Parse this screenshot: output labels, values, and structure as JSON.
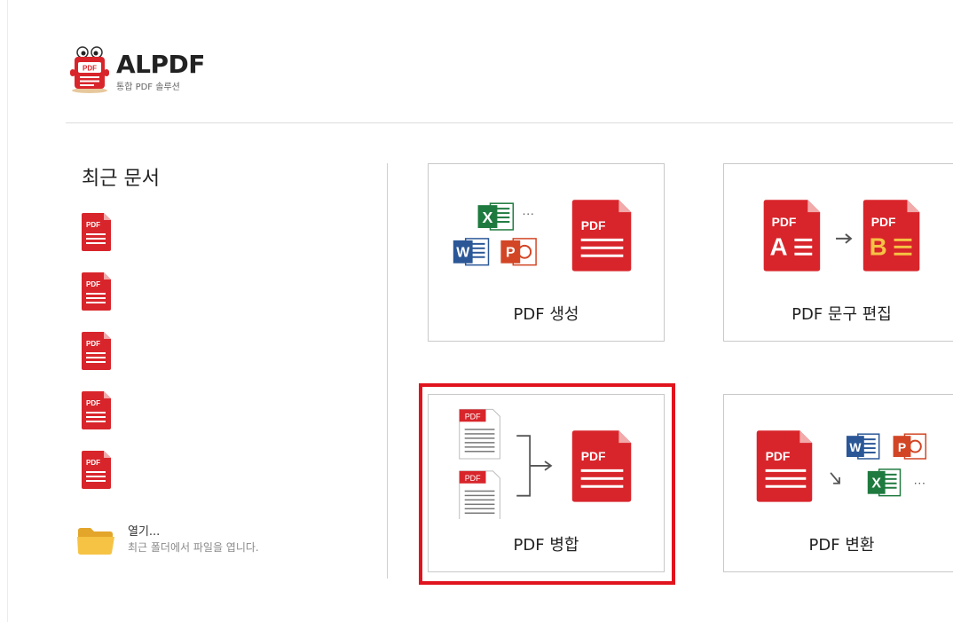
{
  "app": {
    "brand_name": "ALPDF",
    "brand_subtitle": "통합 PDF 솔루션",
    "logo_badge": "PDF"
  },
  "recent": {
    "title": "최근 문서",
    "doc_icon_label": "PDF",
    "items": [
      {
        "icon": "pdf-file-icon"
      },
      {
        "icon": "pdf-file-icon"
      },
      {
        "icon": "pdf-file-icon"
      },
      {
        "icon": "pdf-file-icon"
      },
      {
        "icon": "pdf-file-icon"
      }
    ]
  },
  "open": {
    "label": "열기...",
    "description": "최근 폴더에서 파일을 엽니다."
  },
  "tiles": {
    "create": {
      "label": "PDF 생성",
      "icon": "office-to-pdf-icon"
    },
    "edit": {
      "label": "PDF 문구 편집",
      "icon": "text-edit-icon",
      "letter_a": "A",
      "letter_b": "B"
    },
    "merge": {
      "label": "PDF 병합",
      "icon": "merge-icon"
    },
    "convert": {
      "label": "PDF 변환",
      "icon": "pdf-to-office-icon"
    }
  },
  "icons": {
    "pdf_label": "PDF",
    "excel_letter": "X",
    "word_letter": "W",
    "ppt_letter": "P",
    "ellipsis": "···"
  },
  "colors": {
    "pdf_red": "#d8252b",
    "pdf_fold": "#f2a9a9",
    "excel_green": "#1f7a3f",
    "word_blue": "#2b5797",
    "ppt_orange": "#d24625",
    "highlight_red": "#e0141e",
    "folder_yellow": "#f6c344"
  }
}
